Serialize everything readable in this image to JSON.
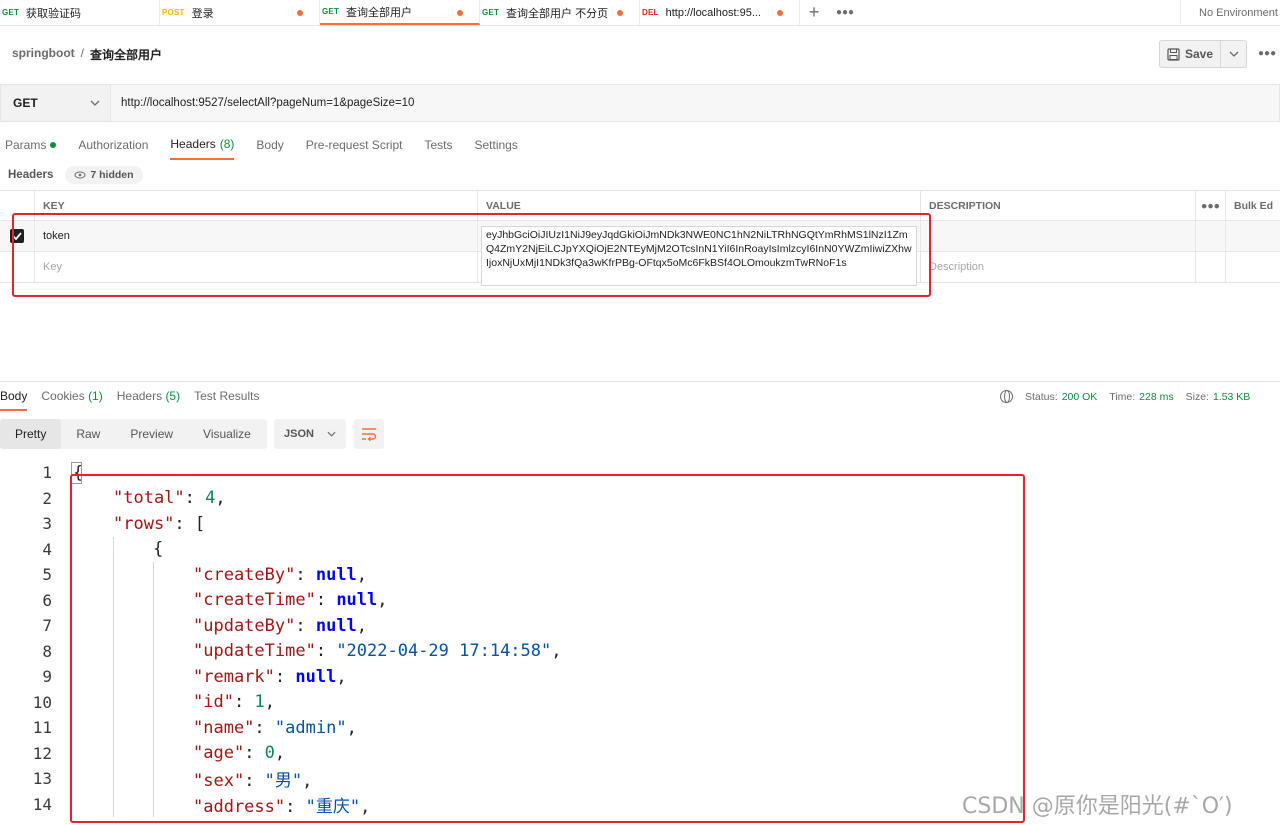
{
  "tabs": [
    {
      "method": "GET",
      "label": "获取验证码",
      "dot": false
    },
    {
      "method": "POST",
      "label": "登录",
      "dot": true
    },
    {
      "method": "GET",
      "label": "查询全部用户",
      "dot": true,
      "active": true
    },
    {
      "method": "GET",
      "label": "查询全部用户 不分页",
      "dot": true
    },
    {
      "method": "DEL",
      "label": "http://localhost:95...",
      "dot": true
    }
  ],
  "environment": "No Environment",
  "breadcrumb": {
    "collection": "springboot",
    "separator": "/",
    "request": "查询全部用户"
  },
  "toolbar": {
    "save_label": "Save"
  },
  "request": {
    "method": "GET",
    "url": "http://localhost:9527/selectAll?pageNum=1&pageSize=10"
  },
  "request_tabs": {
    "params": "Params",
    "authorization": "Authorization",
    "headers": "Headers",
    "headers_count": "(8)",
    "body": "Body",
    "prerequest": "Pre-request Script",
    "tests": "Tests",
    "settings": "Settings"
  },
  "headers_section": {
    "label": "Headers",
    "hidden": "7 hidden"
  },
  "headers_table": {
    "columns": {
      "key": "KEY",
      "value": "VALUE",
      "description": "DESCRIPTION",
      "bulk": "Bulk Ed"
    },
    "rows": [
      {
        "key": "token",
        "value": "eyJhbGciOiJIUzI1NiJ9eyJqdGkiOiJmNDk3NWE0NC1hN2NiLTRhNGQtYmRhMS1lNzI1ZmQ4ZmY2NjEiLCJpYXQiOjE2NTEyMjM2OTcsInN1YiI6InRoayIsImlzcyI6InN0YWZmIiwiZXhwIjoxNjUxMjI1NDk3fQa3wKfrPBg-OFtqx5oMc6FkBSf4OLOmoukzmTwRNoF1s",
        "checked": true
      }
    ],
    "placeholder_key": "Key",
    "placeholder_description": "Description"
  },
  "response_tabs": {
    "body": "Body",
    "cookies": "Cookies",
    "cookies_count": "(1)",
    "headers": "Headers",
    "headers_count": "(5)",
    "tests": "Test Results"
  },
  "response_status": {
    "status_label": "Status:",
    "status": "200 OK",
    "time_label": "Time:",
    "time": "228 ms",
    "size_label": "Size:",
    "size": "1.53 KB"
  },
  "view_modes": [
    "Pretty",
    "Raw",
    "Preview",
    "Visualize"
  ],
  "format": "JSON",
  "code_lines": [
    {
      "n": "1",
      "indent": 0,
      "parts": [
        [
          "p",
          "{"
        ]
      ]
    },
    {
      "n": "2",
      "indent": 1,
      "parts": [
        [
          "k",
          "\"total\""
        ],
        [
          "p",
          ": "
        ],
        [
          "n",
          "4"
        ],
        [
          "p",
          ","
        ]
      ]
    },
    {
      "n": "3",
      "indent": 1,
      "parts": [
        [
          "k",
          "\"rows\""
        ],
        [
          "p",
          ": ["
        ]
      ]
    },
    {
      "n": "4",
      "indent": 2,
      "parts": [
        [
          "p",
          "{"
        ]
      ]
    },
    {
      "n": "5",
      "indent": 3,
      "parts": [
        [
          "k",
          "\"createBy\""
        ],
        [
          "p",
          ": "
        ],
        [
          "kw",
          "null"
        ],
        [
          "p",
          ","
        ]
      ]
    },
    {
      "n": "6",
      "indent": 3,
      "parts": [
        [
          "k",
          "\"createTime\""
        ],
        [
          "p",
          ": "
        ],
        [
          "kw",
          "null"
        ],
        [
          "p",
          ","
        ]
      ]
    },
    {
      "n": "7",
      "indent": 3,
      "parts": [
        [
          "k",
          "\"updateBy\""
        ],
        [
          "p",
          ": "
        ],
        [
          "kw",
          "null"
        ],
        [
          "p",
          ","
        ]
      ]
    },
    {
      "n": "8",
      "indent": 3,
      "parts": [
        [
          "k",
          "\"updateTime\""
        ],
        [
          "p",
          ": "
        ],
        [
          "s",
          "\"2022-04-29 17:14:58\""
        ],
        [
          "p",
          ","
        ]
      ]
    },
    {
      "n": "9",
      "indent": 3,
      "parts": [
        [
          "k",
          "\"remark\""
        ],
        [
          "p",
          ": "
        ],
        [
          "kw",
          "null"
        ],
        [
          "p",
          ","
        ]
      ]
    },
    {
      "n": "10",
      "indent": 3,
      "parts": [
        [
          "k",
          "\"id\""
        ],
        [
          "p",
          ": "
        ],
        [
          "n",
          "1"
        ],
        [
          "p",
          ","
        ]
      ]
    },
    {
      "n": "11",
      "indent": 3,
      "parts": [
        [
          "k",
          "\"name\""
        ],
        [
          "p",
          ": "
        ],
        [
          "s",
          "\"admin\""
        ],
        [
          "p",
          ","
        ]
      ]
    },
    {
      "n": "12",
      "indent": 3,
      "parts": [
        [
          "k",
          "\"age\""
        ],
        [
          "p",
          ": "
        ],
        [
          "n",
          "0"
        ],
        [
          "p",
          ","
        ]
      ]
    },
    {
      "n": "13",
      "indent": 3,
      "parts": [
        [
          "k",
          "\"sex\""
        ],
        [
          "p",
          ": "
        ],
        [
          "s",
          "\"男\""
        ],
        [
          "p",
          ","
        ]
      ]
    },
    {
      "n": "14",
      "indent": 3,
      "parts": [
        [
          "k",
          "\"address\""
        ],
        [
          "p",
          ": "
        ],
        [
          "s",
          "\"重庆\""
        ],
        [
          "p",
          ","
        ]
      ]
    }
  ],
  "watermark": "CSDN @原你是阳光(#`O′)",
  "colors": {
    "accent": "#ff6c37",
    "success": "#0b8f3a",
    "highlight_border": "#e8222a"
  }
}
